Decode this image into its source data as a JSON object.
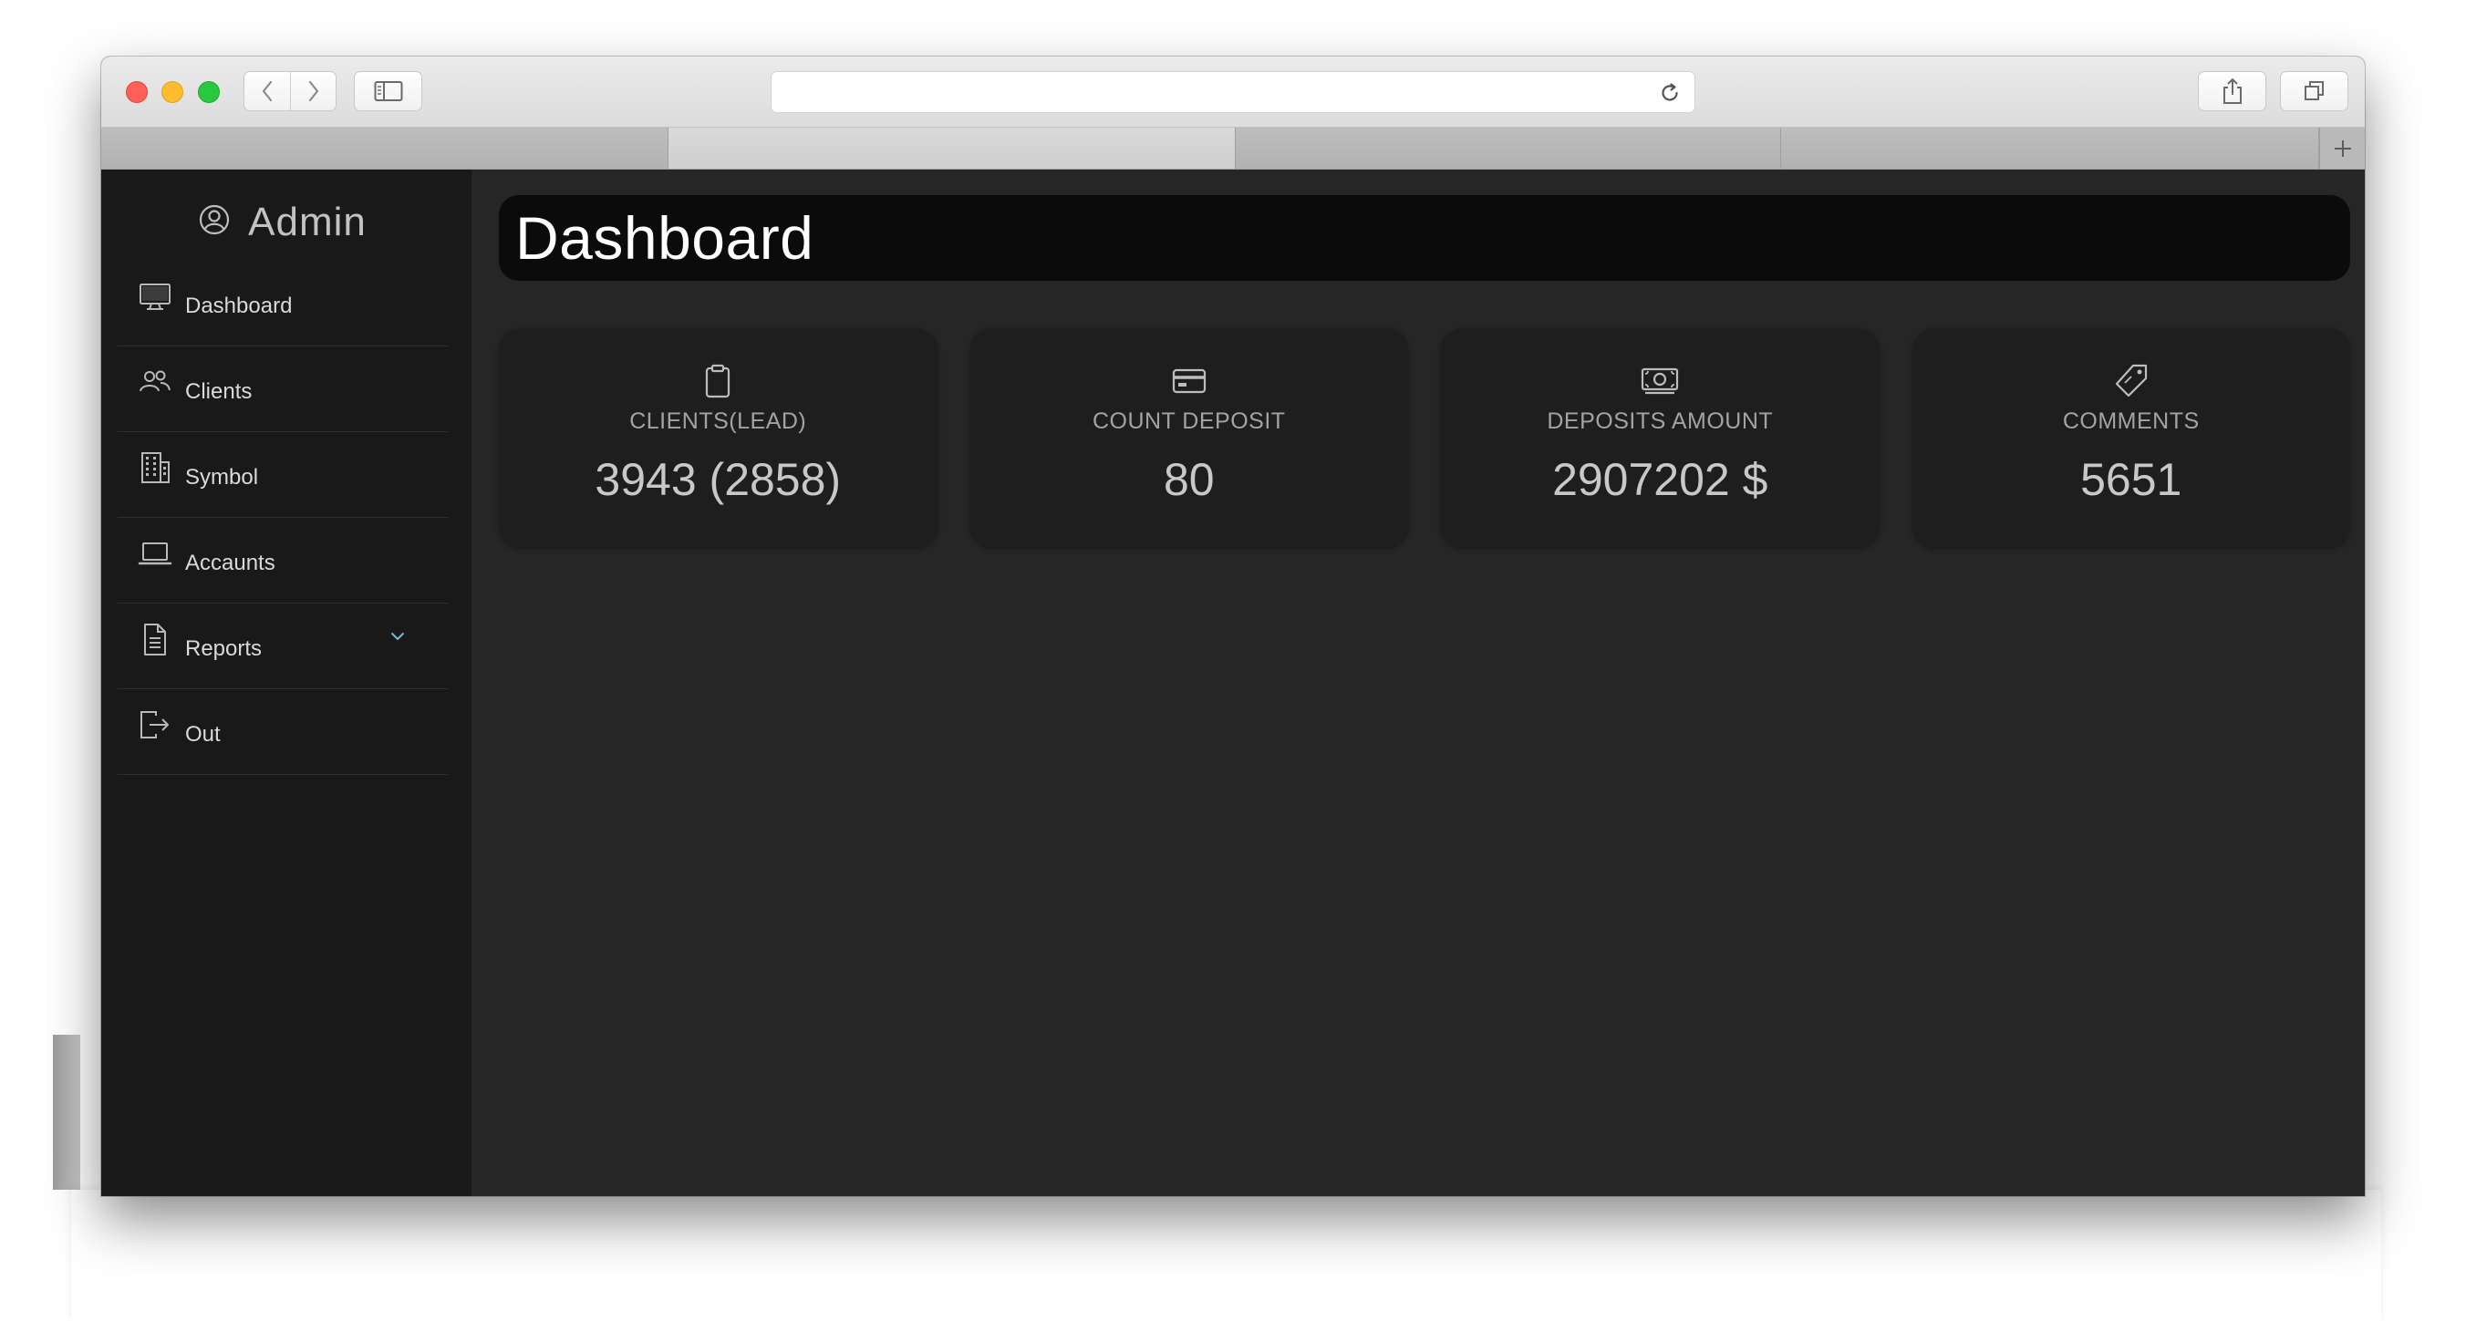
{
  "sidebar": {
    "brand": "Admin",
    "items": [
      {
        "label": "Dashboard",
        "icon": "monitor-icon"
      },
      {
        "label": "Clients",
        "icon": "users-icon"
      },
      {
        "label": "Symbol",
        "icon": "building-icon"
      },
      {
        "label": "Accaunts",
        "icon": "laptop-icon"
      },
      {
        "label": "Reports",
        "icon": "document-icon",
        "has_submenu": true
      },
      {
        "label": "Out",
        "icon": "logout-icon"
      }
    ]
  },
  "main": {
    "title": "Dashboard",
    "cards": [
      {
        "label": "CLIENTS(LEAD)",
        "value": "3943 (2858)",
        "icon": "clipboard-icon"
      },
      {
        "label": "COUNT DEPOSIT",
        "value": "80",
        "icon": "credit-card-icon"
      },
      {
        "label": "DEPOSITS AMOUNT",
        "value": "2907202 $",
        "icon": "cash-icon"
      },
      {
        "label": "COMMENTS",
        "value": "5651",
        "icon": "tag-icon"
      }
    ]
  },
  "colors": {
    "sidebar_bg": "#191919",
    "content_bg": "#262626",
    "card_bg": "#1e1e1e",
    "title_bar_bg": "#0b0b0b",
    "chevron_accent": "#7ab6d8"
  }
}
